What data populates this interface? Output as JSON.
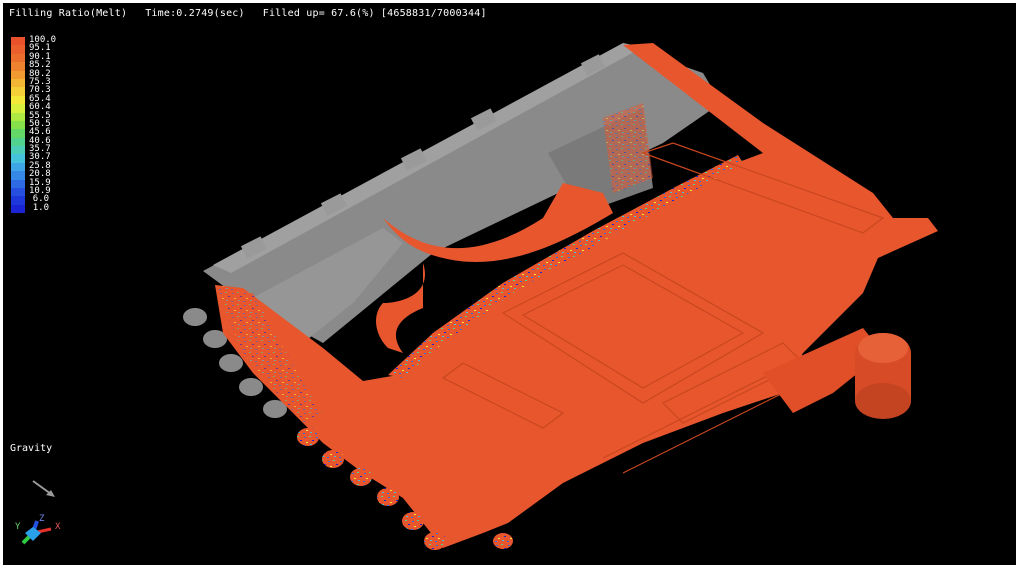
{
  "header": {
    "result_name": "Filling Ratio(Melt)",
    "time": "Time:0.2749(sec)",
    "filled": "Filled up= 67.6(%) [4658831/7000344]"
  },
  "legend": {
    "entries": [
      {
        "label": "100.0",
        "color": "#e8512a"
      },
      {
        "label": "95.1",
        "color": "#ea5f2b"
      },
      {
        "label": "90.1",
        "color": "#ec6e2c"
      },
      {
        "label": "85.2",
        "color": "#ee822e"
      },
      {
        "label": "80.2",
        "color": "#f09a31"
      },
      {
        "label": "75.3",
        "color": "#f3b534"
      },
      {
        "label": "70.3",
        "color": "#f5cf37"
      },
      {
        "label": "65.4",
        "color": "#f3e83a"
      },
      {
        "label": "60.4",
        "color": "#d8ef3d"
      },
      {
        "label": "55.5",
        "color": "#aee843"
      },
      {
        "label": "50.5",
        "color": "#86e04a"
      },
      {
        "label": "45.6",
        "color": "#64d866"
      },
      {
        "label": "40.6",
        "color": "#52d28f"
      },
      {
        "label": "35.7",
        "color": "#4ccdb8"
      },
      {
        "label": "30.7",
        "color": "#45c2dc"
      },
      {
        "label": "25.8",
        "color": "#3ea6e6"
      },
      {
        "label": "20.8",
        "color": "#3688e6"
      },
      {
        "label": "15.9",
        "color": "#2e6ae4"
      },
      {
        "label": "10.9",
        "color": "#264fe0"
      },
      {
        "label": "6.0",
        "color": "#1e37da"
      },
      {
        "label": "1.0",
        "color": "#1a24d4"
      }
    ]
  },
  "gravity": {
    "label": "Gravity"
  },
  "axes": {
    "x": "X",
    "y": "Y",
    "z": "Z"
  },
  "colors": {
    "melt": "#e8562e",
    "empty_cavity": "#8c8c8c",
    "background": "#000000"
  }
}
